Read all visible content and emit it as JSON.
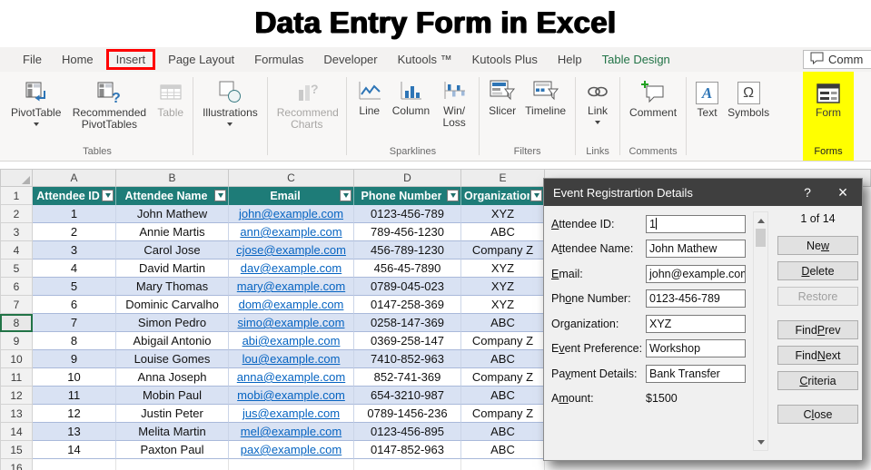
{
  "title_banner": {
    "text": "Data Entry Form in Excel"
  },
  "tabbar": {
    "tabs": [
      {
        "label": "File"
      },
      {
        "label": "Home"
      },
      {
        "label": "Insert",
        "highlight": "red-box"
      },
      {
        "label": "Page Layout"
      },
      {
        "label": "Formulas"
      },
      {
        "label": "Developer"
      },
      {
        "label": "Kutools ™"
      },
      {
        "label": "Kutools Plus"
      },
      {
        "label": "Help"
      },
      {
        "label": "Table Design",
        "highlight": "green"
      }
    ],
    "comments_button": {
      "label": "Comm"
    }
  },
  "ribbon": {
    "tables_group": {
      "label": "Tables",
      "pivottable": "PivotTable",
      "recommended_pivottables": "Recommended PivotTables",
      "table": "Table"
    },
    "illustrations_button": "Illustrations",
    "recommended_charts_button": "Recommend Charts",
    "sparklines_group": {
      "label": "Sparklines",
      "line": "Line",
      "column": "Column",
      "win_loss": "Win/ Loss"
    },
    "filters_group": {
      "label": "Filters",
      "slicer": "Slicer",
      "timeline": "Timeline"
    },
    "links_group": {
      "label": "Links",
      "link": "Link"
    },
    "comments_group": {
      "label": "Comments",
      "comment": "Comment"
    },
    "text_button": "Text",
    "symbols_button": "Symbols",
    "forms_group": {
      "label": "Forms",
      "form": "Form"
    }
  },
  "sheet": {
    "column_letters": [
      "A",
      "B",
      "C",
      "D",
      "E"
    ],
    "header_row_number": "1",
    "headers": [
      "Attendee ID",
      "Attendee Name",
      "Email",
      "Phone Number",
      "Organization"
    ],
    "selected_row_number": 8,
    "empty_row_number": "16",
    "rows": [
      {
        "row": 2,
        "id": "1",
        "name": "John Mathew",
        "email": "john@example.com",
        "phone": "0123-456-789",
        "org": "XYZ"
      },
      {
        "row": 3,
        "id": "2",
        "name": "Annie Martis",
        "email": "ann@example.com",
        "phone": "789-456-1230",
        "org": "ABC"
      },
      {
        "row": 4,
        "id": "3",
        "name": "Carol Jose",
        "email": "cjose@example.com",
        "phone": "456-789-1230",
        "org": "Company Z"
      },
      {
        "row": 5,
        "id": "4",
        "name": "David Martin",
        "email": "dav@example.com",
        "phone": "456-45-7890",
        "org": "XYZ"
      },
      {
        "row": 6,
        "id": "5",
        "name": "Mary Thomas",
        "email": "mary@example.com",
        "phone": "0789-045-023",
        "org": "XYZ"
      },
      {
        "row": 7,
        "id": "6",
        "name": "Dominic Carvalho",
        "email": "dom@example.com",
        "phone": "0147-258-369",
        "org": "XYZ"
      },
      {
        "row": 8,
        "id": "7",
        "name": "Simon Pedro",
        "email": "simo@example.com",
        "phone": "0258-147-369",
        "org": "ABC"
      },
      {
        "row": 9,
        "id": "8",
        "name": "Abigail Antonio",
        "email": "abi@example.com",
        "phone": "0369-258-147",
        "org": "Company Z"
      },
      {
        "row": 10,
        "id": "9",
        "name": "Louise Gomes",
        "email": "lou@example.com",
        "phone": "7410-852-963",
        "org": "ABC"
      },
      {
        "row": 11,
        "id": "10",
        "name": "Anna Joseph",
        "email": "anna@example.com",
        "phone": "852-741-369",
        "org": "Company Z"
      },
      {
        "row": 12,
        "id": "11",
        "name": "Mobin Paul",
        "email": "mobi@example.com",
        "phone": "654-3210-987",
        "org": "ABC"
      },
      {
        "row": 13,
        "id": "12",
        "name": "Justin Peter",
        "email": "jus@example.com",
        "phone": "0789-1456-236",
        "org": "Company Z"
      },
      {
        "row": 14,
        "id": "13",
        "name": "Melita Martin",
        "email": "mel@example.com",
        "phone": "0123-456-895",
        "org": "ABC"
      },
      {
        "row": 15,
        "id": "14",
        "name": "Paxton Paul",
        "email": "pax@example.com",
        "phone": "0147-852-963",
        "org": "ABC"
      }
    ]
  },
  "dialog": {
    "title": "Event Registrartion Details",
    "help_button": "?",
    "close_icon": "×",
    "record_indicator": "1 of 14",
    "fields": [
      {
        "label": "Attendee ID:",
        "accel": 0,
        "value": "1",
        "type": "input-cursor"
      },
      {
        "label": "Attendee Name:",
        "accel": 1,
        "value": "John Mathew",
        "type": "input"
      },
      {
        "label": "Email:",
        "accel": 0,
        "value": "john@example.com",
        "type": "input"
      },
      {
        "label": "Phone Number:",
        "accel": 2,
        "value": "0123-456-789",
        "type": "input"
      },
      {
        "label": "Organization:",
        "accel": 2,
        "value": "XYZ",
        "type": "input"
      },
      {
        "label": "Event Preference:",
        "accel": 1,
        "value": "Workshop",
        "type": "input"
      },
      {
        "label": "Payment Details:",
        "accel": 2,
        "value": "Bank Transfer",
        "type": "input"
      },
      {
        "label": "Amount:",
        "accel": 1,
        "value": "$1500",
        "type": "text"
      }
    ],
    "buttons": [
      {
        "label": "New",
        "accel": 2,
        "gap_before": false,
        "disabled": false
      },
      {
        "label": "Delete",
        "accel": 0,
        "gap_before": false,
        "disabled": false
      },
      {
        "label": "Restore",
        "accel": null,
        "gap_before": false,
        "disabled": true
      },
      {
        "label": "Find Prev",
        "accel": 5,
        "gap_before": true,
        "disabled": false
      },
      {
        "label": "Find Next",
        "accel": 5,
        "gap_before": false,
        "disabled": false
      },
      {
        "label": "Criteria",
        "accel": 0,
        "gap_before": false,
        "disabled": false
      },
      {
        "label": "Close",
        "accel": 1,
        "gap_before": true,
        "disabled": false
      }
    ]
  },
  "colors": {
    "table_header_teal": "#1E7C78",
    "banded_row_blue": "#D9E2F3",
    "email_link_blue": "#0563C1",
    "excel_green": "#217346",
    "form_highlight_yellow": "#FFFF00",
    "insert_box_red": "#FF0000",
    "dialog_titlebar_gray": "#3F3F3F"
  }
}
